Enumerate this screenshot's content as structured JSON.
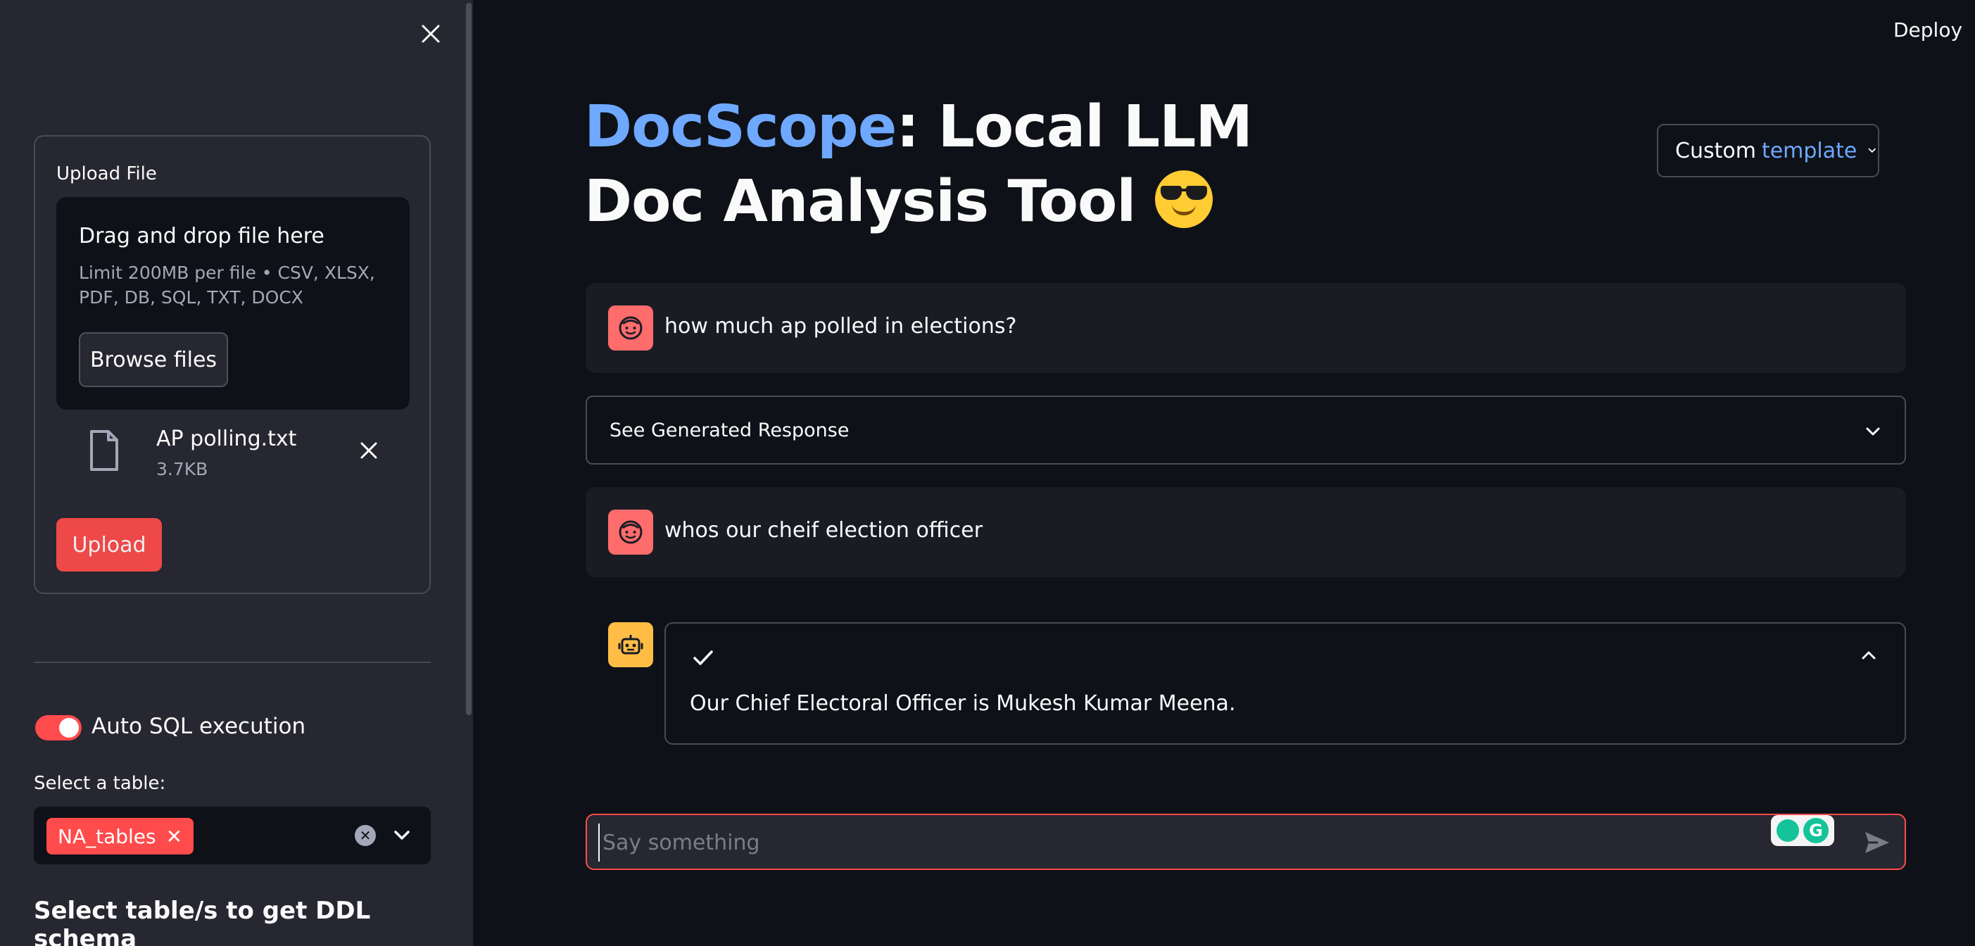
{
  "sidebar": {
    "upload_label": "Upload File",
    "dropzone_title": "Drag and drop file here",
    "dropzone_limit": "Limit 200MB per file • CSV, XLSX, PDF, DB, SQL, TXT, DOCX",
    "browse_label": "Browse files",
    "file": {
      "name": "AP polling.txt",
      "size": "3.7KB"
    },
    "upload_button": "Upload",
    "auto_sql_label": "Auto SQL execution",
    "auto_sql_enabled": true,
    "select_table_label": "Select a table:",
    "selected_tag": "NA_tables",
    "ddl_heading": "Select table/s to get DDL schema"
  },
  "header": {
    "deploy": "Deploy"
  },
  "title": {
    "accent": "DocScope",
    "rest": ": Local LLM Doc Analysis Tool"
  },
  "template_button": {
    "prefix": "Custom",
    "accent": "template"
  },
  "messages": [
    {
      "role": "user",
      "text": "how much ap polled in elections?"
    },
    {
      "role": "user",
      "text": "whos our cheif election officer"
    }
  ],
  "expander_label": "See Generated Response",
  "bot_answer": "Our Chief Electoral Officer is Mukesh Kumar Meena.",
  "chat_input": {
    "placeholder": "Say something"
  },
  "colors": {
    "accent": "#6ea8ff",
    "primary": "#ff4b4b",
    "background": "#0e1117",
    "sidebar": "#262730"
  }
}
